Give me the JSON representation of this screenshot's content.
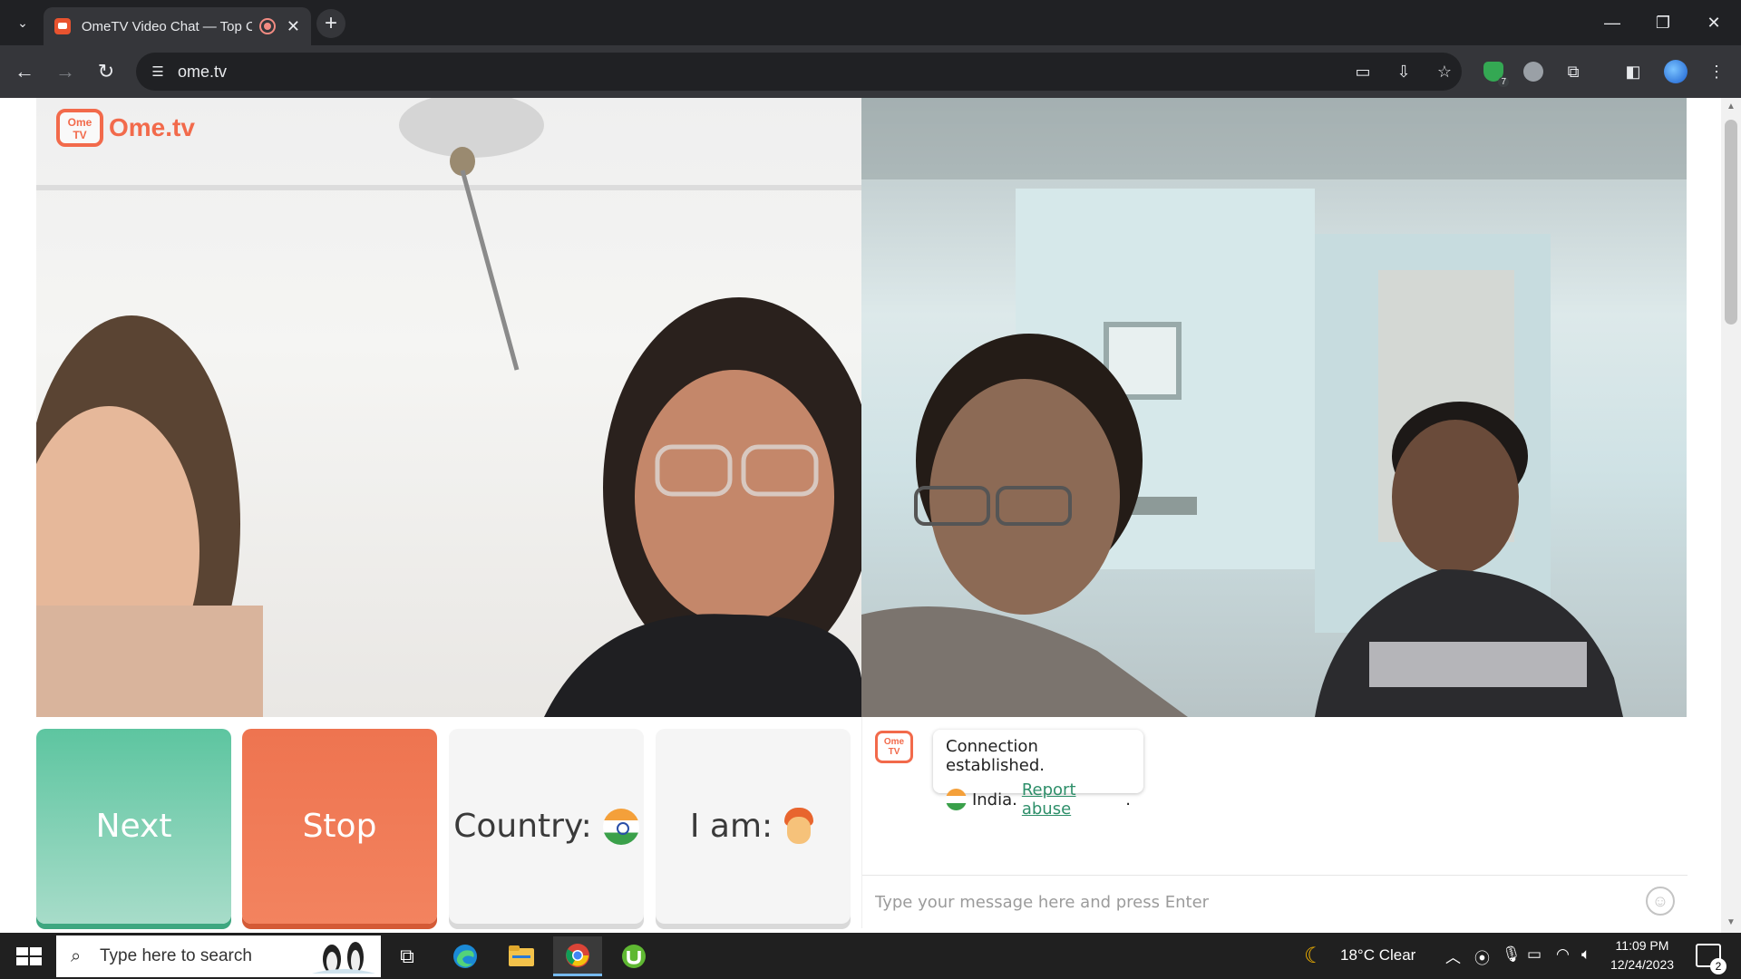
{
  "browser": {
    "tab_title": "OmeTV Video Chat — Top Chat",
    "url": "ome.tv",
    "extension_badge": "7"
  },
  "page": {
    "logo_text": "Ome.tv",
    "logo_tv_text": "Ome TV",
    "buttons": {
      "next": "Next",
      "stop": "Stop",
      "country": "Country:",
      "i_am": "I am:"
    },
    "chat": {
      "message_line1": "Connection established.",
      "country": "India.",
      "report_link": "Report abuse",
      "period": ".",
      "input_placeholder": "Type your message here and press Enter"
    },
    "colors": {
      "next": "#5dc5a0",
      "stop": "#ee7450",
      "brand": "#f26a4b",
      "link": "#2e8f6a"
    }
  },
  "taskbar": {
    "search_placeholder": "Type here to search",
    "weather": "18°C  Clear",
    "time": "11:09 PM",
    "date": "12/24/2023",
    "notification_count": "2",
    "apps": [
      "task-view",
      "edge",
      "file-explorer",
      "chrome",
      "utorrent"
    ]
  }
}
